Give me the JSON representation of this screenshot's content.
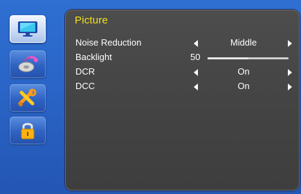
{
  "sidebar": {
    "items": [
      {
        "icon": "monitor-icon",
        "selected": true
      },
      {
        "icon": "audio-disc-icon",
        "selected": false
      },
      {
        "icon": "tools-icon",
        "selected": false
      },
      {
        "icon": "lock-icon",
        "selected": false
      }
    ]
  },
  "menu": {
    "title": "Picture",
    "noise_reduction": {
      "label": "Noise Reduction",
      "value": "Middle"
    },
    "backlight": {
      "label": "Backlight",
      "value": "50",
      "level": 0.5
    },
    "dcr": {
      "label": "DCR",
      "value": "On"
    },
    "dcc": {
      "label": "DCC",
      "value": "On"
    }
  },
  "colors": {
    "title": "#f3e21a",
    "panel": "#444444",
    "background": "#2a66c8"
  }
}
